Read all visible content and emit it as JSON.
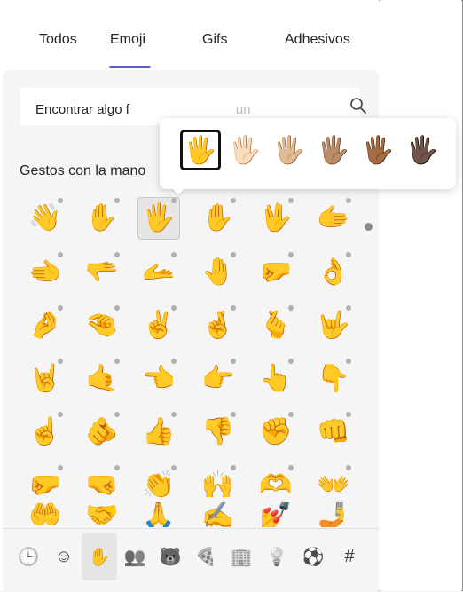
{
  "tabs": [
    {
      "label": "Todos"
    },
    {
      "label": "Emoji"
    },
    {
      "label": "Gifs"
    },
    {
      "label": "Adhesivos"
    }
  ],
  "active_tab": "Emoji",
  "search": {
    "value": "Encontrar algo f",
    "placeholder_tail": "un",
    "icon": "search-icon"
  },
  "section": {
    "title": "Gestos con la mano"
  },
  "skin_tones": [
    "🖐️",
    "🖐🏻",
    "🖐🏼",
    "🖐🏽",
    "🖐🏾",
    "🖐🏿"
  ],
  "skin_tone_selected": 0,
  "emoji_rows": [
    [
      "👋",
      "✋",
      "🖐️",
      "✋",
      "🖖",
      "🫱"
    ],
    [
      "🫲",
      "🫳",
      "🫴",
      "🤚",
      "🤛",
      "👌"
    ],
    [
      "🤌",
      "🤏",
      "✌️",
      "🤞",
      "🫰",
      "🤟"
    ],
    [
      "🤘",
      "🤙",
      "👈",
      "👉",
      "👆",
      "👇"
    ],
    [
      "☝️",
      "🫵",
      "👍",
      "👎",
      "✊",
      "👊"
    ],
    [
      "🤛",
      "🤜",
      "👏",
      "🙌",
      "🫶",
      "👐"
    ],
    [
      "🤲",
      "🤝",
      "🙏",
      "✍️",
      "💅",
      "🤳"
    ]
  ],
  "selected_emoji": [
    0,
    2
  ],
  "categories": [
    {
      "name": "recent-icon",
      "glyph": "🕒"
    },
    {
      "name": "smiley-icon",
      "glyph": "☺"
    },
    {
      "name": "hand-icon",
      "glyph": "✋"
    },
    {
      "name": "people-icon",
      "glyph": "👥"
    },
    {
      "name": "animal-icon",
      "glyph": "🐻"
    },
    {
      "name": "food-icon",
      "glyph": "🍕"
    },
    {
      "name": "building-icon",
      "glyph": "🏢"
    },
    {
      "name": "lightbulb-icon",
      "glyph": "💡"
    },
    {
      "name": "soccer-ball-icon",
      "glyph": "⚽"
    },
    {
      "name": "symbols-icon",
      "glyph": "#"
    }
  ],
  "active_category": 2,
  "colors": {
    "accent": "#5b5fc7",
    "background": "#f5f5f5"
  }
}
